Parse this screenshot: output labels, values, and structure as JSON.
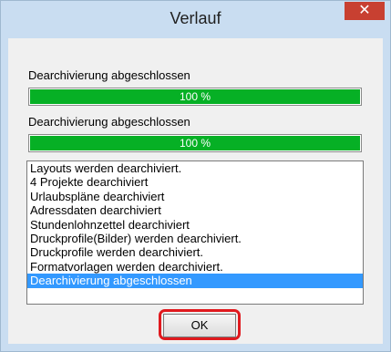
{
  "window": {
    "title": "Verlauf",
    "close_label": "✕"
  },
  "progress1": {
    "label": "Dearchivierung abgeschlossen",
    "percent": 100,
    "text": "100 %"
  },
  "progress2": {
    "label": "Dearchivierung abgeschlossen",
    "percent": 100,
    "text": "100 %"
  },
  "log": {
    "items": [
      "Layouts werden dearchiviert.",
      "4 Projekte dearchiviert",
      "Urlaubspläne dearchiviert",
      "Adressdaten dearchiviert",
      "Stundenlohnzettel dearchiviert",
      "Druckprofile(Bilder) werden dearchiviert.",
      "Druckprofile werden dearchiviert.",
      "Formatvorlagen werden dearchiviert.",
      "Dearchivierung abgeschlossen"
    ],
    "selected_index": 8
  },
  "buttons": {
    "ok_label": "OK"
  },
  "colors": {
    "progress_fill": "#06b025",
    "selection": "#3399ff",
    "highlight": "#e0191e",
    "close_button": "#c84031"
  }
}
